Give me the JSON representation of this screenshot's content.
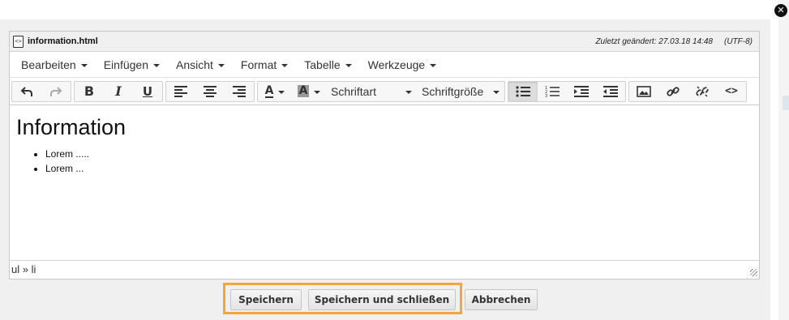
{
  "editor": {
    "file_name": "information.html",
    "last_modified": "Zuletzt geändert: 27.03.18 14:48",
    "encoding": "(UTF-8)",
    "menus": [
      "Bearbeiten",
      "Einfügen",
      "Ansicht",
      "Format",
      "Tabelle",
      "Werkzeuge"
    ],
    "toolbar": {
      "font_family": "Schriftart",
      "font_size": "Schriftgröße",
      "active_button": "bullet-list"
    },
    "content": {
      "heading": "Information",
      "items": [
        "Lorem .....",
        "Lorem ..."
      ]
    },
    "status_path": "ul » li"
  },
  "buttons": {
    "save": "Speichern",
    "save_close": "Speichern und schließen",
    "cancel": "Abbrechen"
  },
  "colors": {
    "highlight": "#f6a53c",
    "dialog_bg": "#f0f0f0"
  }
}
